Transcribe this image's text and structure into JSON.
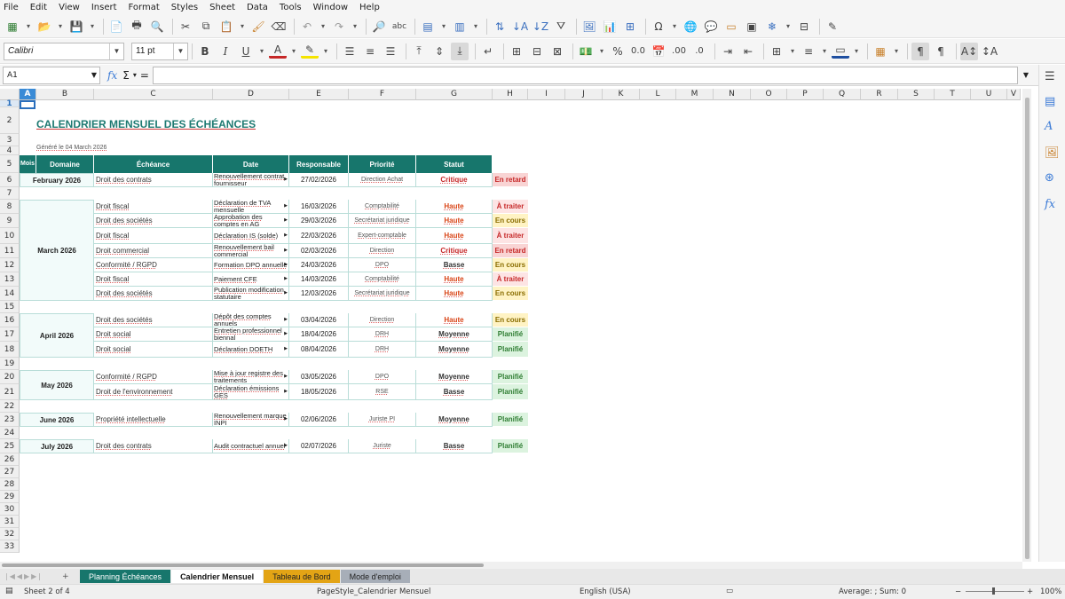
{
  "menu": [
    "File",
    "Edit",
    "View",
    "Insert",
    "Format",
    "Styles",
    "Sheet",
    "Data",
    "Tools",
    "Window",
    "Help"
  ],
  "format_bar": {
    "font_name": "Calibri",
    "font_size": "11 pt",
    "bold": "B",
    "italic": "I",
    "underline": "U",
    "align_percent": "%",
    "decimal_0": "0.0"
  },
  "formula_bar": {
    "cell_ref": "A1",
    "fx": "fx",
    "sigma": "Σ",
    "equals": "="
  },
  "columns": [
    "A",
    "B",
    "C",
    "D",
    "E",
    "F",
    "G",
    "H",
    "I",
    "J",
    "K",
    "L",
    "M",
    "N",
    "O",
    "P",
    "Q",
    "R",
    "S",
    "T",
    "U",
    "V"
  ],
  "rows": [
    "1",
    "2",
    "3",
    "4",
    "5",
    "6",
    "7",
    "8",
    "9",
    "10",
    "11",
    "12",
    "13",
    "14",
    "15",
    "16",
    "17",
    "18",
    "19",
    "20",
    "21",
    "22",
    "23",
    "24",
    "25",
    "26",
    "27",
    "28",
    "29",
    "30",
    "31",
    "32",
    "33"
  ],
  "sheet": {
    "title": "CALENDRIER MENSUEL DES ÉCHÉANCES",
    "generated": "Généré le 04 March 2026",
    "headers": {
      "mois": "Mois",
      "domaine": "Domaine",
      "echeance": "Échéance",
      "date": "Date",
      "responsable": "Responsable",
      "priorite": "Priorité",
      "statut": "Statut"
    },
    "months": [
      {
        "label": "February 2026"
      },
      {
        "label": "March 2026"
      },
      {
        "label": "April 2026"
      },
      {
        "label": "May 2026"
      },
      {
        "label": "June 2026"
      },
      {
        "label": "July 2026"
      }
    ],
    "rows": [
      {
        "domaine": "Droit des contrats",
        "echeance": "Renouvellement contrat fournisseur",
        "date": "27/02/2026",
        "responsable": "Direction Achat",
        "priorite": "Critique",
        "statut": "En retard"
      },
      {
        "domaine": "Droit fiscal",
        "echeance": "Déclaration de TVA mensuelle",
        "date": "16/03/2026",
        "responsable": "Comptabilité",
        "priorite": "Haute",
        "statut": "À traiter"
      },
      {
        "domaine": "Droit des sociétés",
        "echeance": "Approbation des comptes en AG",
        "date": "29/03/2026",
        "responsable": "Secrétariat juridique",
        "priorite": "Haute",
        "statut": "En cours"
      },
      {
        "domaine": "Droit fiscal",
        "echeance": "Déclaration IS (solde)",
        "date": "22/03/2026",
        "responsable": "Expert-comptable",
        "priorite": "Haute",
        "statut": "À traiter"
      },
      {
        "domaine": "Droit commercial",
        "echeance": "Renouvellement bail commercial",
        "date": "02/03/2026",
        "responsable": "Direction",
        "priorite": "Critique",
        "statut": "En retard"
      },
      {
        "domaine": "Conformité / RGPD",
        "echeance": "Formation DPO annuelle",
        "date": "24/03/2026",
        "responsable": "DPO",
        "priorite": "Basse",
        "statut": "En cours"
      },
      {
        "domaine": "Droit fiscal",
        "echeance": "Paiement CFE",
        "date": "14/03/2026",
        "responsable": "Comptabilité",
        "priorite": "Haute",
        "statut": "À traiter"
      },
      {
        "domaine": "Droit des sociétés",
        "echeance": "Publication modification statutaire",
        "date": "12/03/2026",
        "responsable": "Secrétariat juridique",
        "priorite": "Haute",
        "statut": "En cours"
      },
      {
        "domaine": "Droit des sociétés",
        "echeance": "Dépôt des comptes annuels",
        "date": "03/04/2026",
        "responsable": "Direction",
        "priorite": "Haute",
        "statut": "En cours"
      },
      {
        "domaine": "Droit social",
        "echeance": "Entretien professionnel biennal",
        "date": "18/04/2026",
        "responsable": "DRH",
        "priorite": "Moyenne",
        "statut": "Planifié"
      },
      {
        "domaine": "Droit social",
        "echeance": "Déclaration DOETH",
        "date": "08/04/2026",
        "responsable": "DRH",
        "priorite": "Moyenne",
        "statut": "Planifié"
      },
      {
        "domaine": "Conformité / RGPD",
        "echeance": "Mise à jour registre des traitements",
        "date": "03/05/2026",
        "responsable": "DPO",
        "priorite": "Moyenne",
        "statut": "Planifié"
      },
      {
        "domaine": "Droit de l'environnement",
        "echeance": "Déclaration émissions GES",
        "date": "18/05/2026",
        "responsable": "RSE",
        "priorite": "Basse",
        "statut": "Planifié"
      },
      {
        "domaine": "Propriété intellectuelle",
        "echeance": "Renouvellement marque INPI",
        "date": "02/06/2026",
        "responsable": "Juriste PI",
        "priorite": "Moyenne",
        "statut": "Planifié"
      },
      {
        "domaine": "Droit des contrats",
        "echeance": "Audit contractuel annuel",
        "date": "02/07/2026",
        "responsable": "Juriste",
        "priorite": "Basse",
        "statut": "Planifié"
      }
    ]
  },
  "colors": {
    "header_teal": "#17766c",
    "critique": "#c62828",
    "haute": "#d84315",
    "moyenne": "#333333",
    "basse": "#333333",
    "retard_bg": "#f9d4d4",
    "retard_fg": "#c62828",
    "traiter_bg": "#fde4e4",
    "traiter_fg": "#c62828",
    "cours_bg": "#fff3c4",
    "cours_fg": "#8a6d00",
    "planifie_bg": "#dcf3df",
    "planifie_fg": "#2e7d32"
  },
  "tabs": [
    "Planning Échéances",
    "Calendrier Mensuel",
    "Tableau de Bord",
    "Mode d'emploi"
  ],
  "status": {
    "sheet": "Sheet 2 of 4",
    "pagestyle": "PageStyle_Calendrier Mensuel",
    "lang": "English (USA)",
    "summary": "Average: ; Sum: 0",
    "zoom": "100%"
  }
}
